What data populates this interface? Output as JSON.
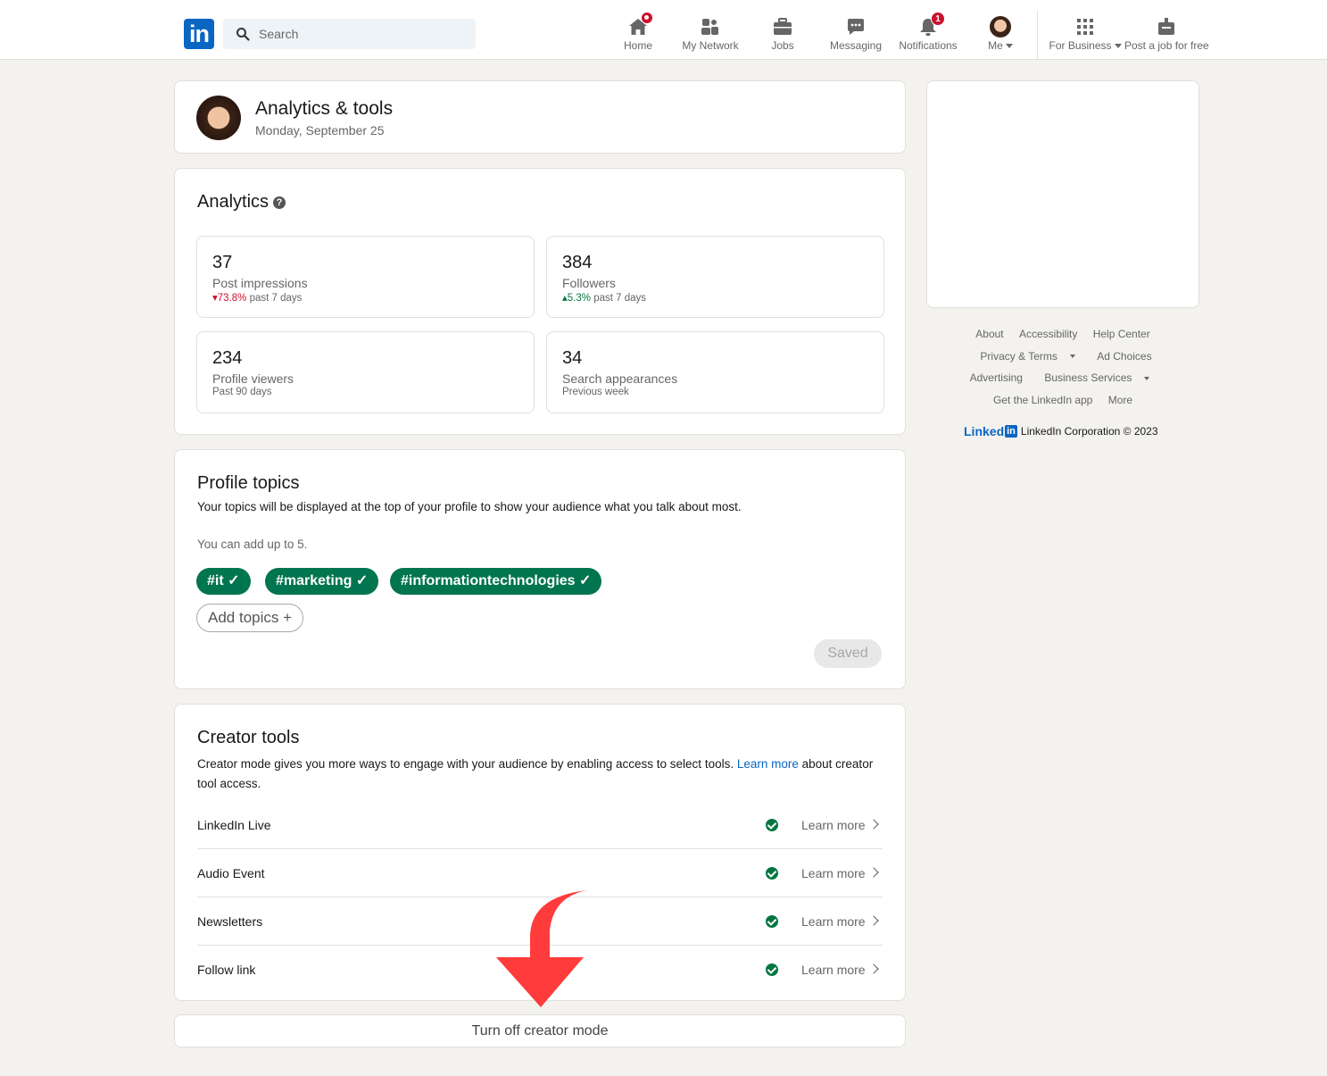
{
  "nav": {
    "logo": "in",
    "search_placeholder": "Search",
    "items": [
      {
        "label": "Home",
        "icon": "home-icon"
      },
      {
        "label": "My Network",
        "icon": "network-icon"
      },
      {
        "label": "Jobs",
        "icon": "briefcase-icon"
      },
      {
        "label": "Messaging",
        "icon": "messaging-icon"
      },
      {
        "label": "Notifications",
        "icon": "bell-icon",
        "badge": "1"
      },
      {
        "label": "Me",
        "icon": "avatar"
      },
      {
        "label": "For Business",
        "icon": "grid-icon"
      },
      {
        "label": "Post a job for free",
        "icon": "post-job-icon"
      }
    ]
  },
  "header": {
    "title": "Analytics & tools",
    "date": "Monday, September 25"
  },
  "analytics": {
    "title": "Analytics",
    "stats": [
      {
        "value": "37",
        "label": "Post impressions",
        "trend": "73.8%",
        "trend_dir": "down",
        "period": "past 7 days"
      },
      {
        "value": "384",
        "label": "Followers",
        "trend": "5.3%",
        "trend_dir": "up",
        "period": "past 7 days"
      },
      {
        "value": "234",
        "label": "Profile viewers",
        "period": "Past 90 days"
      },
      {
        "value": "34",
        "label": "Search appearances",
        "period": "Previous week"
      }
    ]
  },
  "topics": {
    "title": "Profile topics",
    "description": "Your topics will be displayed at the top of your profile to show your audience what you talk about most.",
    "limit": "You can add up to 5.",
    "pills": [
      "#it",
      "#marketing",
      "#informationtechnologies"
    ],
    "add_label": "Add topics",
    "saved_label": "Saved"
  },
  "creator": {
    "title": "Creator tools",
    "desc_before": "Creator mode gives you more ways to engage with your audience by enabling access to select tools. ",
    "desc_link": "Learn more",
    "desc_after": " about creator tool access.",
    "tools": [
      {
        "name": "LinkedIn Live",
        "link": "Learn more"
      },
      {
        "name": "Audio Event",
        "link": "Learn more"
      },
      {
        "name": "Newsletters",
        "link": "Learn more"
      },
      {
        "name": "Follow link",
        "link": "Learn more"
      }
    ],
    "turn_off_label": "Turn off creator mode"
  },
  "footer": {
    "links_row1": [
      "About",
      "Accessibility",
      "Help Center"
    ],
    "links_row2": [
      "Privacy & Terms",
      "Ad Choices"
    ],
    "links_row3": [
      "Advertising",
      "Business Services"
    ],
    "links_row4": [
      "Get the LinkedIn app",
      "More"
    ],
    "brand_word": "Linked",
    "brand_in": "in",
    "copyright": "LinkedIn Corporation © 2023"
  },
  "colors": {
    "brand_blue": "#0a66c2",
    "topic_green": "#01754f",
    "badge_red": "#cb112d",
    "arrow_red": "#ff3b3b"
  }
}
